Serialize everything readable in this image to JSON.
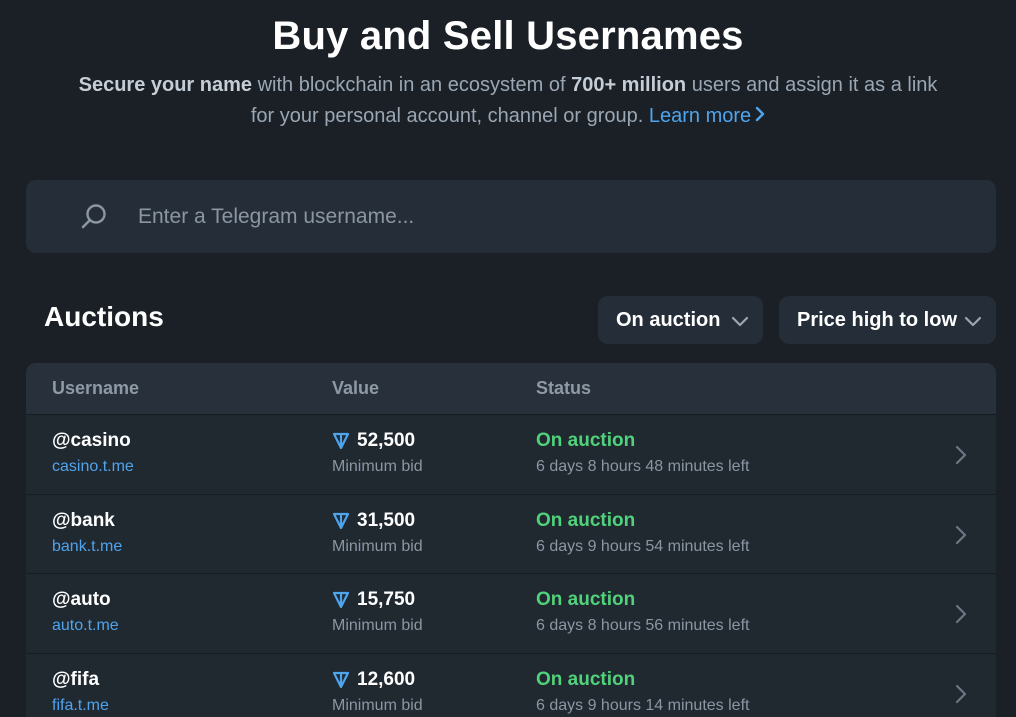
{
  "hero": {
    "title": "Buy and Sell Usernames",
    "sub_bold1": "Secure your name",
    "sub_text1": " with blockchain in an ecosystem of ",
    "sub_bold2": "700+ million",
    "sub_text2": " users and assign it as a link for your personal account, channel or group. ",
    "learn_more": "Learn more"
  },
  "search": {
    "placeholder": "Enter a Telegram username...",
    "value": ""
  },
  "auctions": {
    "title": "Auctions",
    "filter_status": "On auction",
    "sort": "Price high to low"
  },
  "table": {
    "headers": {
      "username": "Username",
      "value": "Value",
      "status": "Status"
    },
    "rows": [
      {
        "username": "@casino",
        "link": "casino.t.me",
        "value": "52,500",
        "value_sub": "Minimum bid",
        "status": "On auction",
        "time_left": "6 days 8 hours 48 minutes left"
      },
      {
        "username": "@bank",
        "link": "bank.t.me",
        "value": "31,500",
        "value_sub": "Minimum bid",
        "status": "On auction",
        "time_left": "6 days 9 hours 54 minutes left"
      },
      {
        "username": "@auto",
        "link": "auto.t.me",
        "value": "15,750",
        "value_sub": "Minimum bid",
        "status": "On auction",
        "time_left": "6 days 8 hours 56 minutes left"
      },
      {
        "username": "@fifa",
        "link": "fifa.t.me",
        "value": "12,600",
        "value_sub": "Minimum bid",
        "status": "On auction",
        "time_left": "6 days 9 hours 14 minutes left"
      }
    ]
  },
  "colors": {
    "background": "#1a2026",
    "panel": "#252e38",
    "link": "#4fa4ee",
    "status_active": "#4fd27a",
    "ton_icon": "#4fa4ee"
  },
  "icons": {
    "search": "search-icon",
    "caret": "chevron-down-icon",
    "currency": "ton-icon",
    "row_open": "chevron-right-icon"
  }
}
